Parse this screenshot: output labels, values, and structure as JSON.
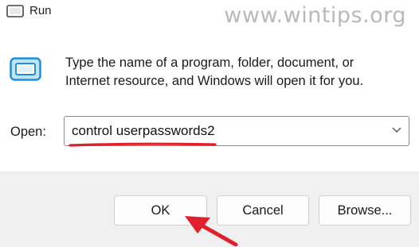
{
  "window": {
    "title": "Run",
    "watermark": "www.wintips.org"
  },
  "dialog": {
    "description": "Type the name of a program, folder, document, or Internet resource, and Windows will open it for you.",
    "open_label": "Open:",
    "open_value": "control userpasswords2",
    "dropdown_icon": "chevron-down-icon"
  },
  "buttons": {
    "ok": "OK",
    "cancel": "Cancel",
    "browse": "Browse..."
  },
  "annotations": {
    "color": "#e0202a"
  },
  "icons": {
    "title": "run-icon",
    "app": "run-app-icon"
  }
}
